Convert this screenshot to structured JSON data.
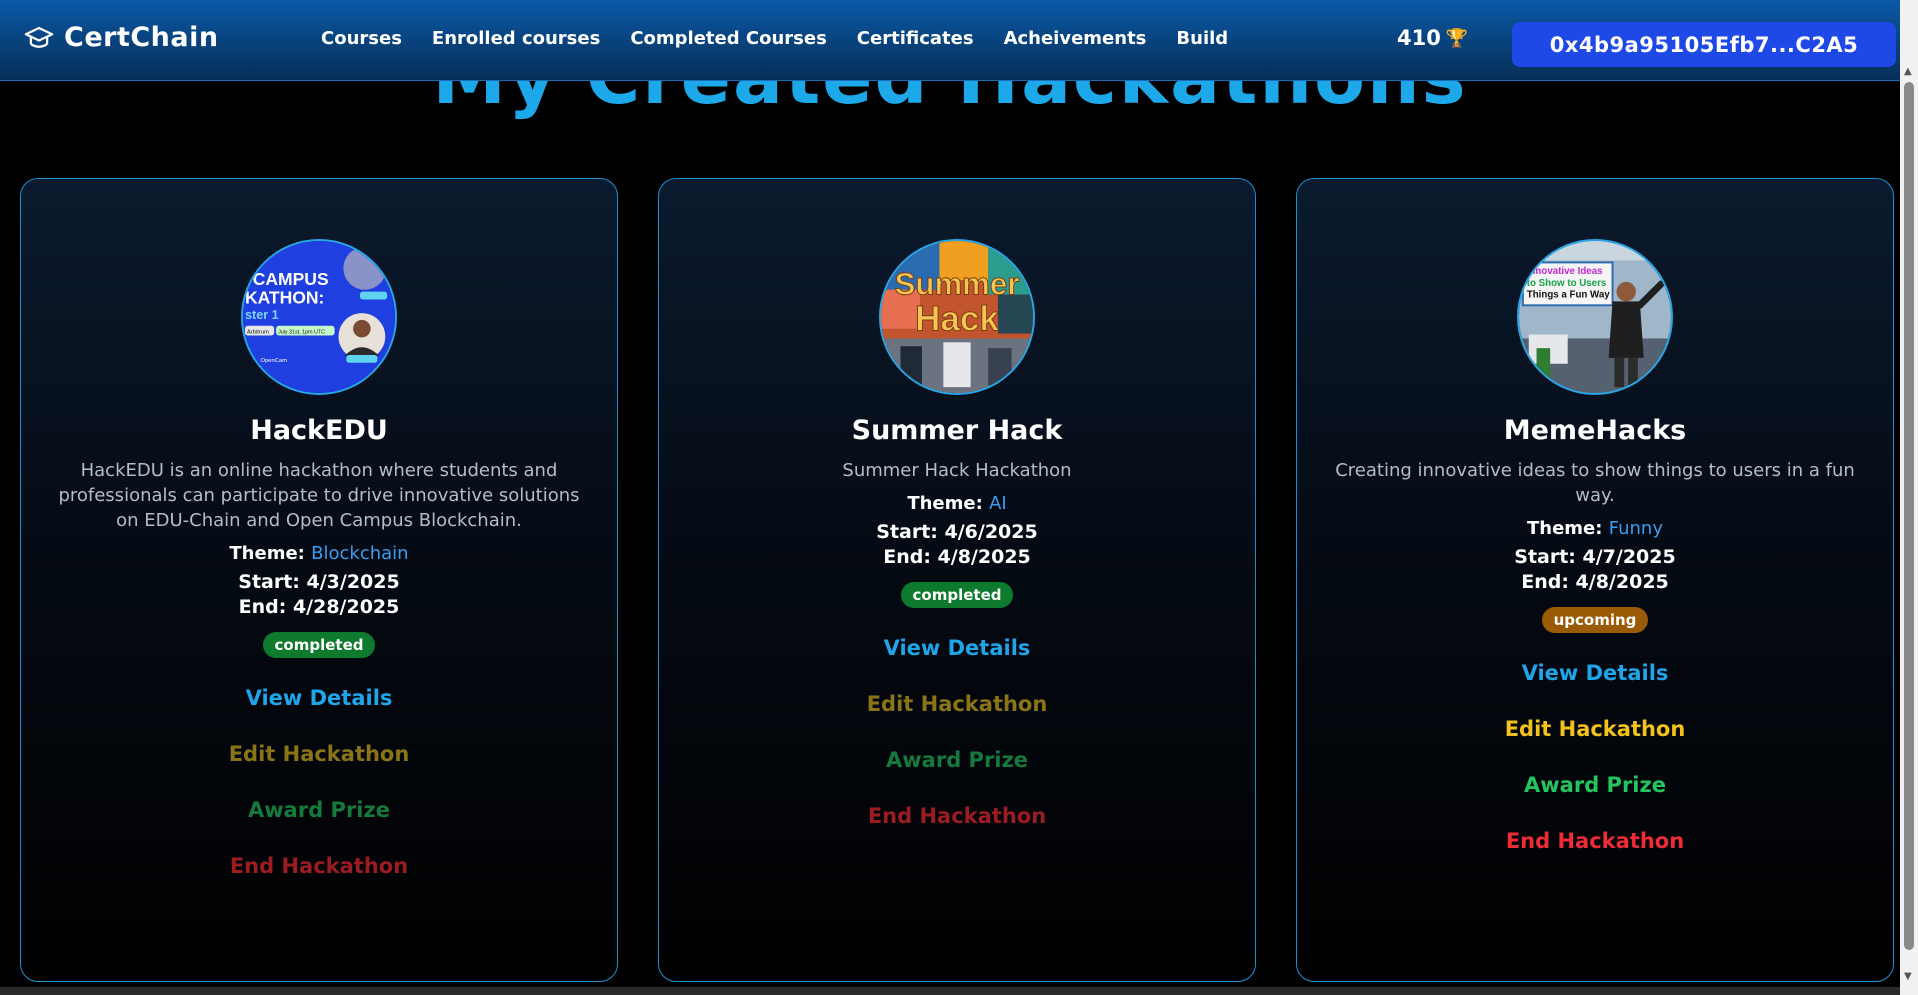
{
  "nav": {
    "brand": "CertChain",
    "links": [
      "Courses",
      "Enrolled courses",
      "Completed Courses",
      "Certificates",
      "Acheivements",
      "Build"
    ],
    "points": "410",
    "wallet": "0x4b9a95105Efb7...C2A5"
  },
  "page": {
    "title": "My Created Hackathons"
  },
  "hackathons": [
    {
      "name": "HackEDU",
      "description": "HackEDU is an online hackathon where students and professionals can participate to drive innovative solutions on EDU-Chain and Open Campus Blockchain.",
      "theme_label": "Theme:",
      "theme": "Blockchain",
      "start": "Start: 4/3/2025",
      "end": "End: 4/28/2025",
      "status": "completed",
      "image_text": [
        "CAMPUS",
        "KATHON:",
        "ster 1",
        "Arbitrum",
        "July 31st, 1pm UTC",
        "OpenCam"
      ],
      "actions": {
        "view": "View Details",
        "edit": "Edit Hackathon",
        "award": "Award Prize",
        "end": "End Hackathon"
      }
    },
    {
      "name": "Summer Hack",
      "description": "Summer Hack Hackathon",
      "theme_label": "Theme:",
      "theme": "AI",
      "start": "Start: 4/6/2025",
      "end": "End: 4/8/2025",
      "status": "completed",
      "image_text": [
        "Summer",
        "Hack"
      ],
      "actions": {
        "view": "View Details",
        "edit": "Edit Hackathon",
        "award": "Award Prize",
        "end": "End Hackathon"
      }
    },
    {
      "name": "MemeHacks",
      "description": "Creating innovative ideas to show things to users in a fun way.",
      "theme_label": "Theme:",
      "theme": "Funny",
      "start": "Start: 4/7/2025",
      "end": "End: 4/8/2025",
      "status": "upcoming",
      "image_text": [
        "Innovative Ideas",
        "to Show to Users",
        "Things a Fun Way"
      ],
      "actions": {
        "view": "View Details",
        "edit": "Edit Hackathon",
        "award": "Award Prize",
        "end": "End Hackathon"
      }
    }
  ],
  "colors": {
    "accent": "#1da8ea",
    "wallet_bg": "#1e49e6",
    "completed_badge": "#0e7a2e",
    "upcoming_badge": "#9a5a06",
    "edit": "#f2c21b",
    "award": "#22c55e",
    "end": "#ef2c36"
  }
}
